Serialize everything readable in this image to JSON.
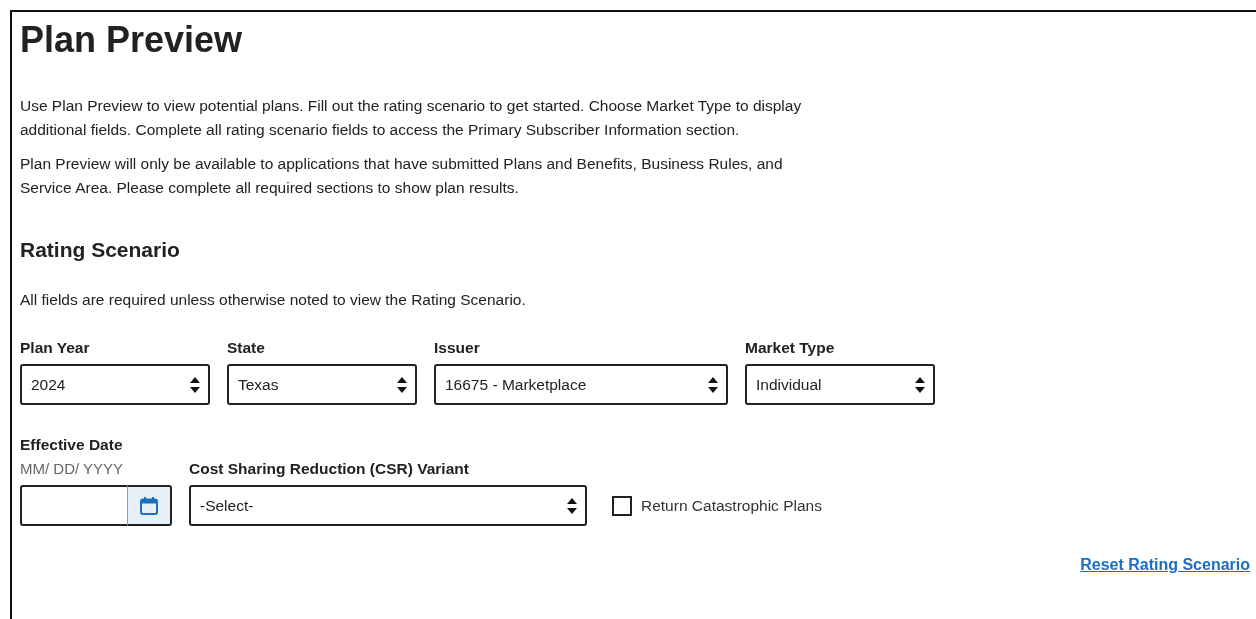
{
  "title": "Plan Preview",
  "intro": [
    "Use Plan Preview to view potential plans. Fill out the rating scenario to get started. Choose Market Type to display additional fields. Complete all rating scenario fields to access the Primary Subscriber Information section.",
    "Plan Preview will only be available to applications that have submitted Plans and Benefits, Business Rules, and Service Area. Please complete all required sections to show plan results."
  ],
  "section": {
    "heading": "Rating Scenario",
    "note": "All fields are required unless otherwise noted to view the Rating Scenario."
  },
  "field_rows": [
    [
      {
        "kind": "select",
        "label": "Plan Year",
        "value": "2024"
      },
      {
        "kind": "select",
        "label": "State",
        "value": "Texas"
      },
      {
        "kind": "select",
        "label": "Issuer",
        "value": "16675 - Marketplace"
      },
      {
        "kind": "select",
        "label": "Market Type",
        "value": "Individual"
      }
    ],
    [
      {
        "kind": "date",
        "label": "Effective Date",
        "hint": "MM/ DD/ YYYY"
      },
      {
        "kind": "select",
        "label": "Cost Sharing Reduction (CSR) Variant",
        "value": "-Select-"
      },
      {
        "kind": "checkbox",
        "label": "Return Catastrophic Plans",
        "checked": false
      }
    ]
  ],
  "reset_link": "Reset Rating Scenario"
}
